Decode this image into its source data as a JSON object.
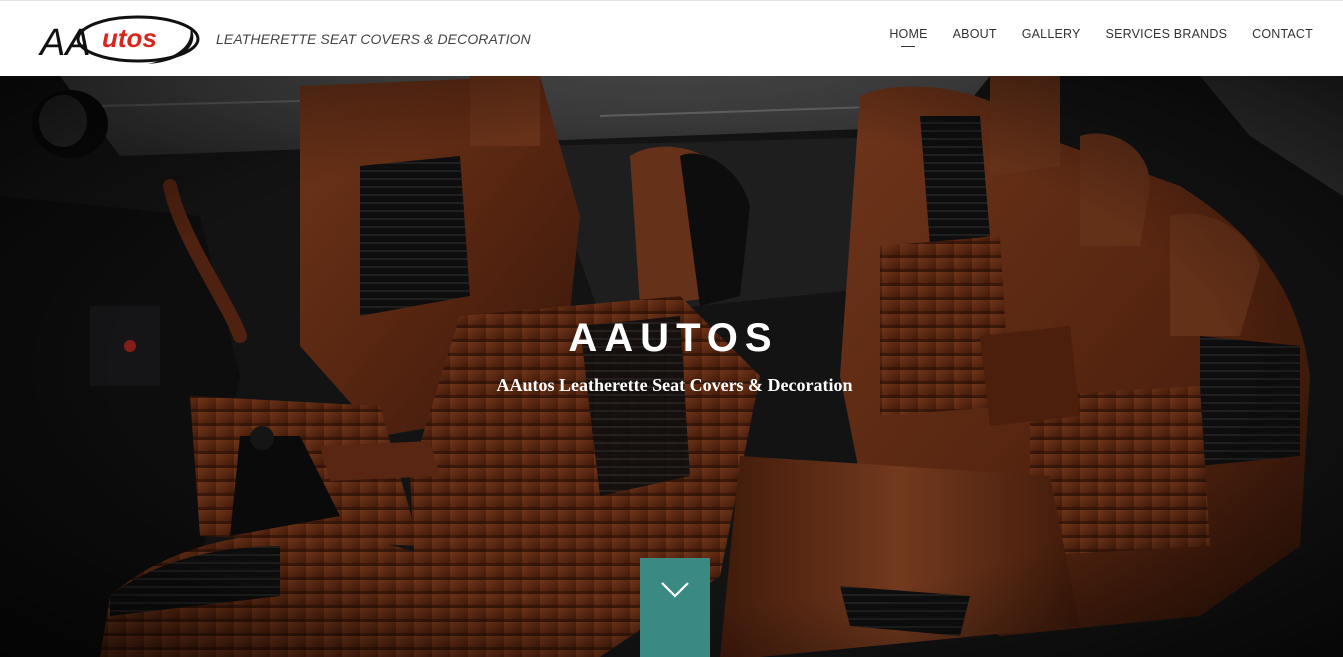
{
  "header": {
    "logo_text_a": "AA",
    "logo_text_b": "utos",
    "tagline": "LEATHERETTE SEAT COVERS & DECORATION"
  },
  "nav": {
    "items": [
      {
        "label": "HOME",
        "active": true
      },
      {
        "label": "ABOUT",
        "active": false
      },
      {
        "label": "GALLERY",
        "active": false
      },
      {
        "label": "SERVICES BRANDS",
        "active": false
      },
      {
        "label": "CONTACT",
        "active": false
      }
    ]
  },
  "hero": {
    "title": "AAUTOS",
    "subtitle": "AAutos Leatherette Seat Covers & Decoration"
  },
  "colors": {
    "accent": "#3a8a83",
    "logo_red": "#d8261f",
    "leather": "#7a3a1e"
  },
  "icons": {
    "scroll": "chevron-down-icon"
  }
}
